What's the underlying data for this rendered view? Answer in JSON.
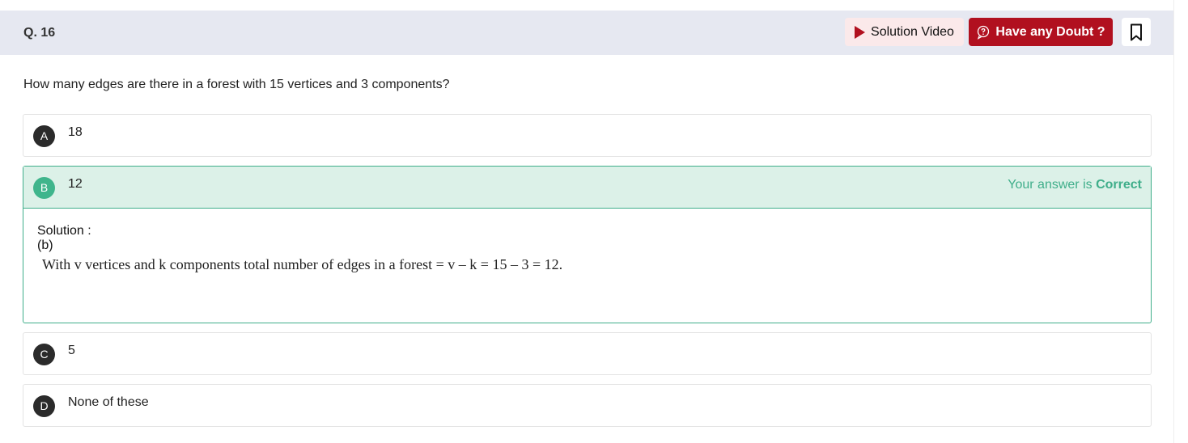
{
  "header": {
    "question_number": "Q. 16",
    "solution_video_label": "Solution Video",
    "doubt_label": "Have any Doubt ?",
    "accent_color": "#b1101f"
  },
  "question": {
    "text": "How many edges are there in a forest with 15 vertices and 3 components?"
  },
  "options": [
    {
      "letter": "A",
      "text": "18"
    },
    {
      "letter": "B",
      "text": "12"
    },
    {
      "letter": "C",
      "text": "5"
    },
    {
      "letter": "D",
      "text": "None of these"
    }
  ],
  "result": {
    "prefix": "Your answer is",
    "status": "Correct",
    "color": "#3fae8a"
  },
  "solution": {
    "title": "Solution :",
    "answer": "(b)",
    "text": "With v vertices and k components total number of edges in a forest = v – k = 15 – 3 = 12."
  }
}
